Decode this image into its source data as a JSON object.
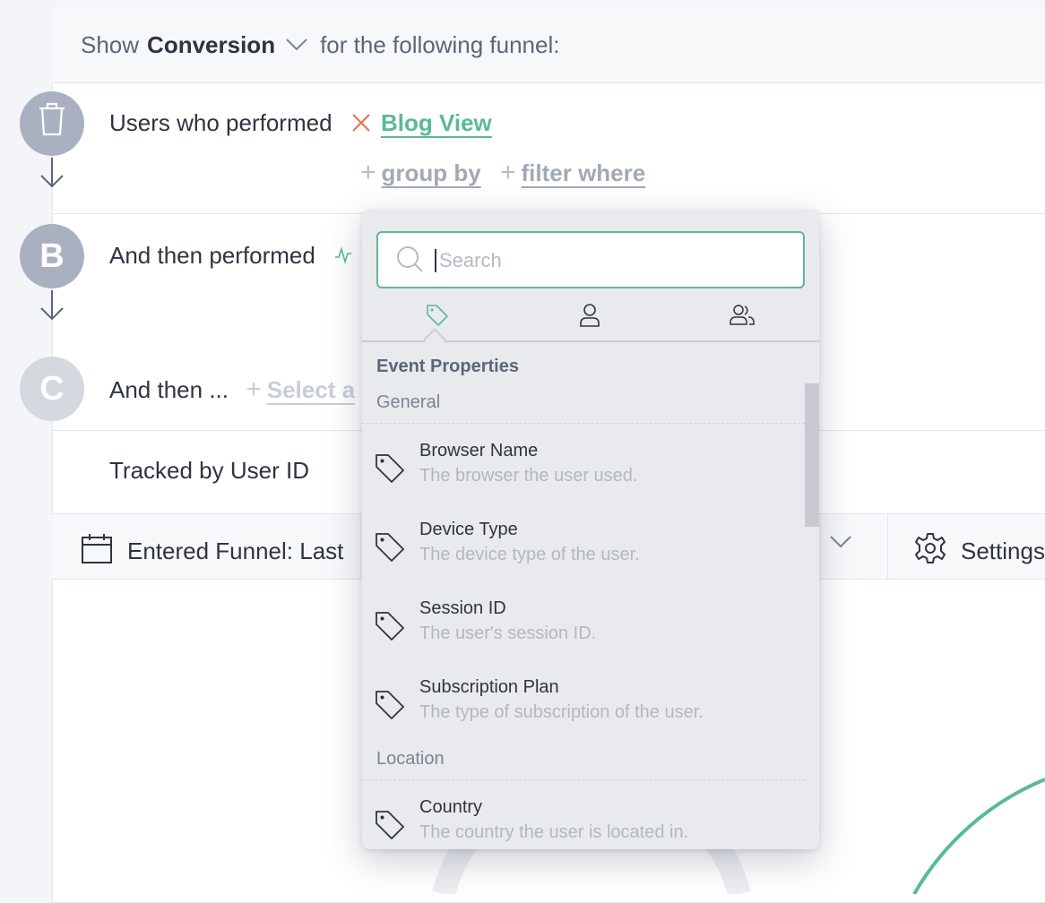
{
  "header": {
    "prefix": "Show",
    "metric": "Conversion",
    "suffix": "for the following funnel:"
  },
  "steps": [
    {
      "marker": "",
      "label": "Users who performed",
      "event": "Blog View",
      "group_by": "group by",
      "filter_where": "filter where"
    },
    {
      "marker": "B",
      "label": "And then performed"
    },
    {
      "marker": "C",
      "label": "And then ...",
      "placeholder": "Select a"
    }
  ],
  "tracked_by": "Tracked by User ID",
  "bottom_bar": {
    "date_range": "Entered Funnel: Last",
    "settings": "Settings"
  },
  "dropdown": {
    "search_placeholder": "Search",
    "search_value": "",
    "tabs": [
      "event-properties",
      "user-properties",
      "group-properties"
    ],
    "section_title": "Event Properties",
    "groups": [
      {
        "name": "General",
        "items": [
          {
            "name": "Browser Name",
            "desc": "The browser the user used."
          },
          {
            "name": "Device Type",
            "desc": "The device type of the user."
          },
          {
            "name": "Session ID",
            "desc": "The user's session ID."
          },
          {
            "name": "Subscription Plan",
            "desc": "The type of subscription of the user."
          }
        ]
      },
      {
        "name": "Location",
        "items": [
          {
            "name": "Country",
            "desc": "The country the user is located in."
          }
        ]
      }
    ]
  },
  "colors": {
    "accent_green": "#5aba94",
    "remove_red": "#e8704f",
    "step_a": "#a9b1c1",
    "step_b": "#a9b1c1",
    "step_c": "#d4d8df"
  },
  "icons": {
    "delete_step": "trash-icon",
    "remove_event": "close-x-icon",
    "event_activity": "activity-icon",
    "calendar": "calendar-icon",
    "settings": "gear-icon",
    "search": "search-icon",
    "tab_event": "tag-icon",
    "tab_user": "user-icon",
    "tab_group": "users-icon",
    "property": "tag-icon"
  }
}
